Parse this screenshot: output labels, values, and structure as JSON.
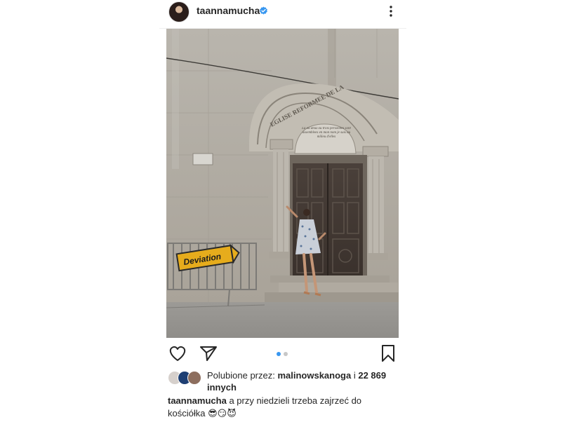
{
  "header": {
    "username": "taannamucha"
  },
  "photo": {
    "arch_inscription": "EGLISE REFORMEE DE LA",
    "plaque_text": "La ou deux ou trois personnes sont assemblees en mon nom je suis au milieu d'elles",
    "sign_text": "Deviation"
  },
  "carousel": {
    "total": 2,
    "active": 1
  },
  "likes": {
    "prefix": "Polubione przez:",
    "user": "malinowskanoga",
    "connector": "i",
    "count": "22 869",
    "suffix": "innych"
  },
  "caption": {
    "user": "taannamucha",
    "text": "a przy niedzieli trzeba zajrzeć do kościółka",
    "emojis": "😎😏😈"
  },
  "colors": {
    "verified": "#3897f0",
    "dot_active": "#3897f0",
    "dot_inactive": "#c7c7c7"
  }
}
